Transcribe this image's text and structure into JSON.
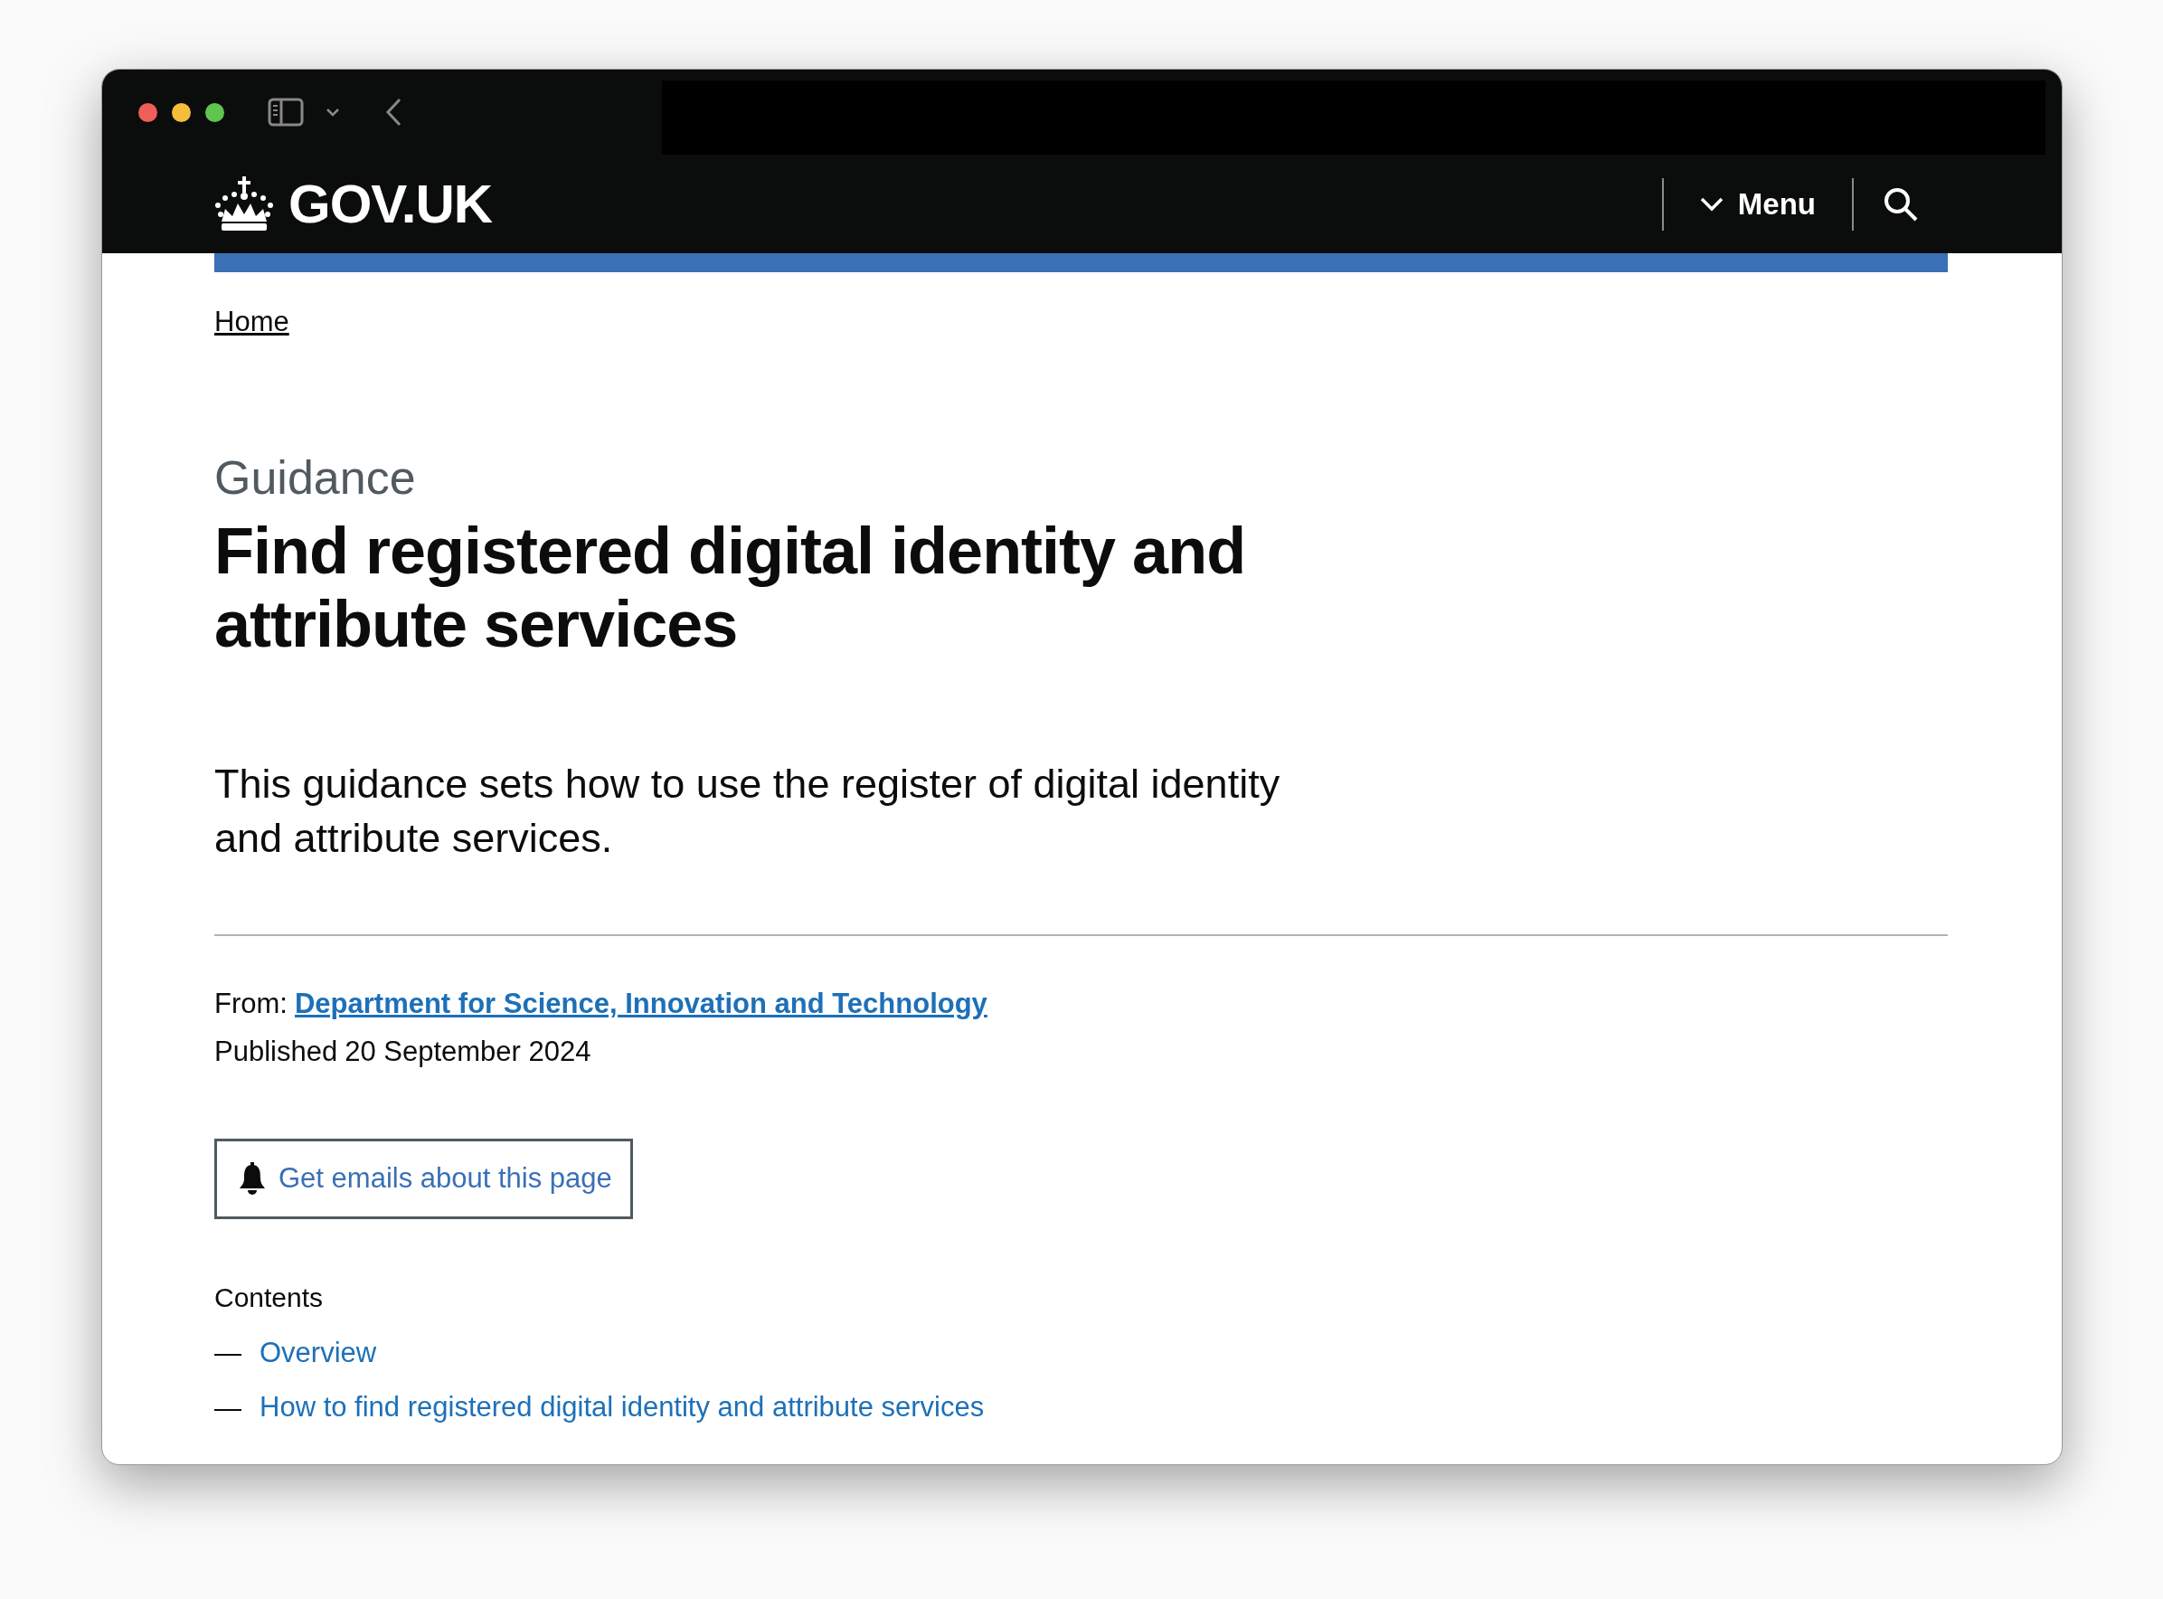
{
  "header": {
    "logo": "GOV.UK",
    "menu": "Menu"
  },
  "breadcrumbs": [
    {
      "label": "Home"
    }
  ],
  "caption": "Guidance",
  "title": "Find registered digital identity and attribute services",
  "lead": "This guidance sets how to use the register of digital identity and attribute services.",
  "metadata": {
    "from_label": "From:",
    "from_value": "Department for Science, Innovation and Technology",
    "published_label": "Published",
    "published_value": "20 September 2024"
  },
  "email_button": "Get emails about this page",
  "contents": {
    "heading": "Contents",
    "items": [
      {
        "marker": "—",
        "label": "Overview"
      },
      {
        "marker": "—",
        "label": "How to find registered digital identity and attribute services"
      }
    ]
  }
}
